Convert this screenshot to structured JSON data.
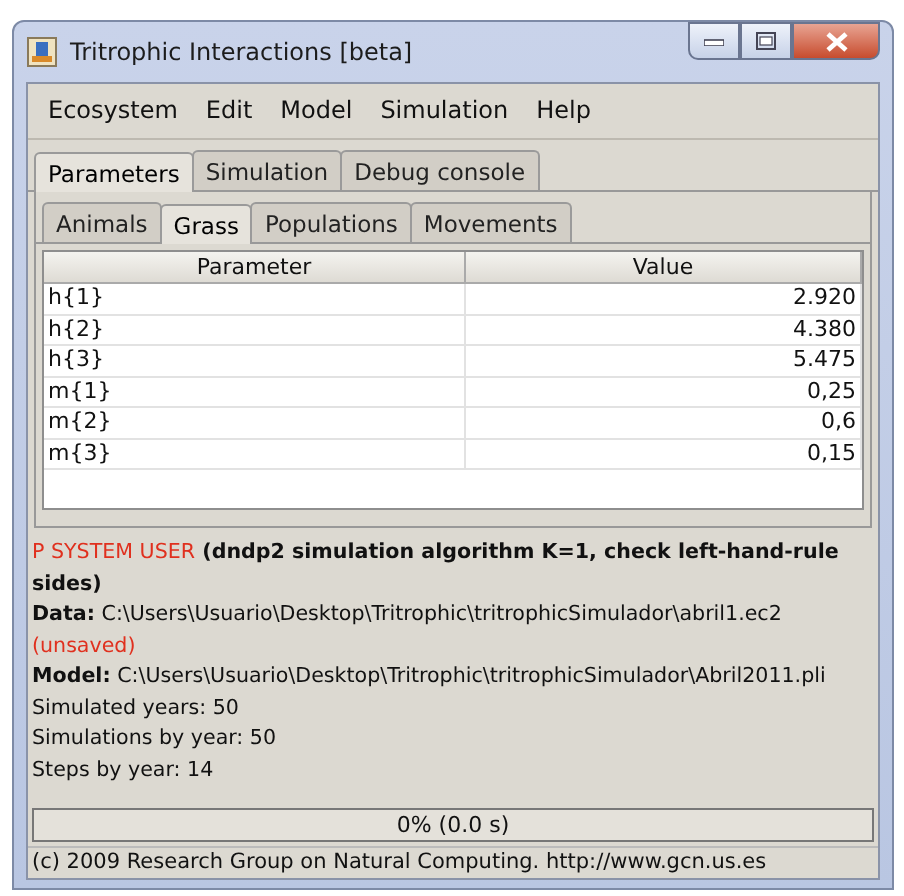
{
  "window": {
    "title": "Tritrophic Interactions [beta]"
  },
  "menu": [
    "Ecosystem",
    "Edit",
    "Model",
    "Simulation",
    "Help"
  ],
  "tabs": [
    {
      "label": "Parameters",
      "selected": true
    },
    {
      "label": "Simulation",
      "selected": false
    },
    {
      "label": "Debug console",
      "selected": false
    }
  ],
  "subtabs": [
    {
      "label": "Animals",
      "selected": false
    },
    {
      "label": "Grass",
      "selected": true
    },
    {
      "label": "Populations",
      "selected": false
    },
    {
      "label": "Movements",
      "selected": false
    }
  ],
  "table": {
    "columns": [
      "Parameter",
      "Value"
    ],
    "rows": [
      [
        "h{1}",
        "2.920"
      ],
      [
        "h{2}",
        "4.380"
      ],
      [
        "h{3}",
        "5.475"
      ],
      [
        "m{1}",
        "0,25"
      ],
      [
        "m{2}",
        "0,6"
      ],
      [
        "m{3}",
        "0,15"
      ]
    ]
  },
  "info": {
    "system": "P SYSTEM USER",
    "algorithm": "(dndp2 simulation algorithm K=1, check left-hand-rule sides)"
  },
  "files": [
    {
      "label": "Data:",
      "path": "C:\\Users\\Usuario\\Desktop\\Tritrophic\\tritrophicSimulador\\abril1.ec2",
      "note": "(unsaved)"
    },
    {
      "label": "Model:",
      "path": "C:\\Users\\Usuario\\Desktop\\Tritrophic\\tritrophicSimulador\\Abril2011.pli"
    }
  ],
  "stats": [
    "Simulated years: 50",
    "Simulations by year: 50",
    "Steps by year: 14"
  ],
  "progress": {
    "text": "0% (0.0 s)"
  },
  "footer": "(c) 2009 Research Group on Natural Computing. http://www.gcn.us.es"
}
